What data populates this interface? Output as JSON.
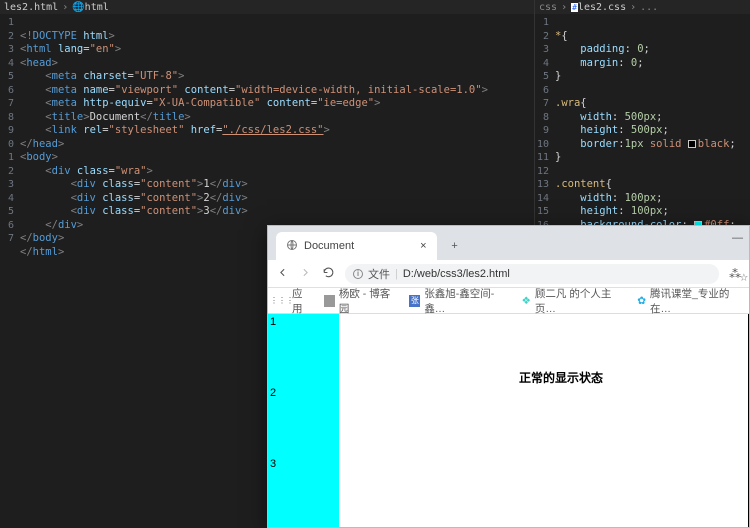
{
  "left": {
    "breadcrumb_file": "les2.html",
    "breadcrumb_sep": "›",
    "breadcrumb_el": "html",
    "lines": {
      "1": "<!DOCTYPE html>",
      "2": "<html lang=\"en\">",
      "3": "<head>",
      "4": "    <meta charset=\"UTF-8\">",
      "5": "    <meta name=\"viewport\" content=\"width=device-width, initial-scale=1.0\">",
      "6": "    <meta http-equiv=\"X-UA-Compatible\" content=\"ie=edge\">",
      "7": "    <title>Document</title>",
      "8": "    <link rel=\"stylesheet\" href=\"./css/les2.css\">",
      "9": "</head>",
      "10": "<body>",
      "11": "    <div class=\"wra\">",
      "12": "        <div class=\"content\">1</div>",
      "13": "        <div class=\"content\">2</div>",
      "14": "        <div class=\"content\">3</div>",
      "15": "    </div>",
      "16": "</body>",
      "17": "</html>"
    },
    "line_nums": [
      "1",
      "2",
      "3",
      "4",
      "5",
      "6",
      "7",
      "8",
      "9",
      "0",
      "1",
      "2",
      "3",
      "4",
      "5",
      "6",
      "7"
    ]
  },
  "right": {
    "breadcrumb_dir": "css",
    "breadcrumb_file": "les2.css",
    "breadcrumb_more": "...",
    "line_nums": [
      "1",
      "2",
      "3",
      "4",
      "5",
      "6",
      "7",
      "8",
      "9",
      "10",
      "11",
      "12",
      "13",
      "14",
      "15",
      "16"
    ],
    "css": {
      "sel1": "*{",
      "p1": "padding: 0;",
      "p2": "margin: 0;",
      "close1": "}",
      "sel2": ".wra{",
      "p3": "width: 500px;",
      "p4": "height: 500px;",
      "p5a": "border:1px solid ",
      "p5b": "black;",
      "close2": "}",
      "sel3": ".content{",
      "p6": "width: 100px;",
      "p7": "height: 100px;",
      "p8a": "background-color: ",
      "p8b": "#0ff;"
    }
  },
  "browser": {
    "tab_title": "Document",
    "url_prefix": "文件",
    "url": "D:/web/css3/les2.html",
    "bm_apps": "应用",
    "bm1": "杨欧 - 博客园",
    "bm2": "张鑫旭-鑫空间-鑫…",
    "bm3": "顾二凡 的个人主页…",
    "bm4": "腾讯课堂_专业的在…",
    "cell1": "1",
    "cell2": "2",
    "cell3": "3",
    "caption": "正常的显示状态",
    "close": "×",
    "plus": "+",
    "minimize": "—"
  }
}
